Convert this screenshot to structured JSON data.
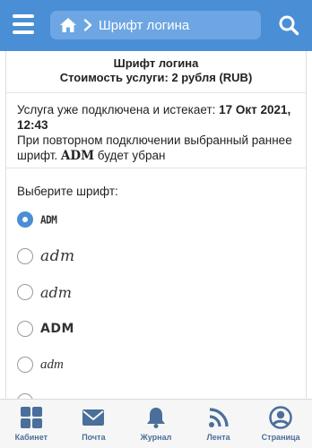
{
  "header": {
    "title": "Шрифт логина",
    "menu_icon": "hamburger-icon",
    "home_icon": "home-icon",
    "search_icon": "search-icon",
    "accent": "#4a8ed6"
  },
  "service": {
    "name": "Шрифт логина",
    "cost": "Стоимость услуги: 2 рубля (RUB)"
  },
  "info": {
    "connected_prefix": "Услуга уже подключена и истекает: ",
    "expires": "17 Окт 2021, 12:43",
    "reconnect_prefix": "При повторном подключении выбранный раннее шрифт. ",
    "login": "ADM",
    "reconnect_suffix": " будет убран"
  },
  "font_select": {
    "label": "Выберите шрифт:",
    "selected_index": 0,
    "options": [
      {
        "sample": "ADM"
      },
      {
        "sample": "adm"
      },
      {
        "sample": "adm"
      },
      {
        "sample": "ADM"
      },
      {
        "sample": "adm"
      }
    ]
  },
  "bottom_nav": [
    {
      "label": "Кабинет",
      "icon": "grid-icon"
    },
    {
      "label": "Почта",
      "icon": "envelope-icon"
    },
    {
      "label": "Журнал",
      "icon": "bell-icon"
    },
    {
      "label": "Лента",
      "icon": "rss-icon"
    },
    {
      "label": "Страница",
      "icon": "user-icon"
    }
  ]
}
